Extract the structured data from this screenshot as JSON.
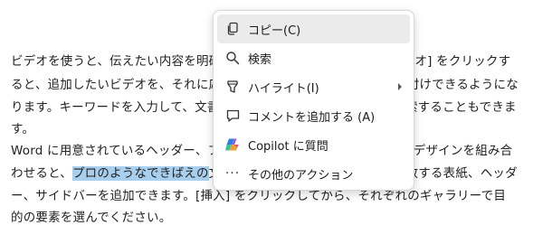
{
  "document": {
    "lines": [
      {
        "text": "ビデオを使うと、伝えたい内容を明確に表現できます。[オンライン ビデオ] をクリックす"
      },
      {
        "text": "ると、追加したいビデオを、それに応じた埋め込みコードの形式で貼り付けできるようにな"
      },
      {
        "text": "ります。キーワードを入力して、文書に最適なビデオをオンラインで検索することもできま"
      },
      {
        "text": "す。"
      },
      {
        "text": "Word に用意されているヘッダー、フッター、表紙、テキスト ボックス デザインを組み合"
      },
      {
        "before": "わせると、",
        "highlight": "プロのようなできばえの",
        "after": "文書を作成できます。たとえば、一致する表紙、ヘッダ"
      },
      {
        "text": "ー、サイドバーを追加できます。[挿入] をクリックしてから、それぞれのギャラリーで目"
      },
      {
        "text": "的の要素を選んでください。"
      }
    ]
  },
  "context_menu": {
    "items": [
      {
        "label": "コピー(C)",
        "icon": "copy-icon"
      },
      {
        "label": "検索",
        "icon": "search-icon"
      },
      {
        "label": "ハイライト(I)",
        "icon": "highlighter-icon",
        "submenu_arrow": "chevron-right-icon"
      },
      {
        "label": "コメントを追加する (A)",
        "icon": "comment-icon"
      },
      {
        "label": "Copilot に質問",
        "icon": "copilot-icon"
      },
      {
        "label": "その他のアクション",
        "icon": "more-icon"
      }
    ],
    "active_item": "コピー(C)"
  },
  "colors": {
    "selection_highlight": "#a8cfee",
    "menu_active": "#ebebeb",
    "text": "#222222"
  }
}
